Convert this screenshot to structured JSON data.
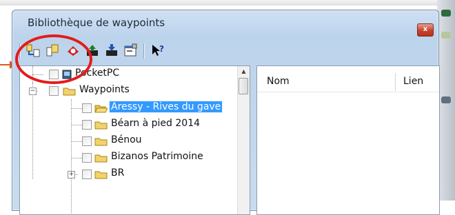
{
  "window": {
    "title": "Bibliothèque de waypoints",
    "close_glyph": "x"
  },
  "toolbar": {
    "buttons": [
      {
        "icon": "import-waypoint-icon"
      },
      {
        "icon": "copy-waypoint-icon"
      },
      {
        "icon": "gps-receiver-icon"
      },
      {
        "icon": "upload-to-device-icon"
      },
      {
        "icon": "download-from-device-icon"
      },
      {
        "icon": "properties-icon"
      },
      {
        "icon": "help-pointer-icon"
      }
    ]
  },
  "tree": {
    "items": [
      {
        "label": "PocketPC",
        "kind": "device",
        "selected": false
      },
      {
        "label": "Waypoints",
        "kind": "folder",
        "selected": false,
        "expanded": true
      },
      {
        "label": "Aressy - Rives du gave",
        "kind": "folder-open",
        "selected": true
      },
      {
        "label": "Béarn à pied 2014",
        "kind": "folder",
        "selected": false
      },
      {
        "label": "Bénou",
        "kind": "folder",
        "selected": false
      },
      {
        "label": "Bizanos Patrimoine",
        "kind": "folder",
        "selected": false
      },
      {
        "label": "BR",
        "kind": "folder",
        "selected": false,
        "expandable": true
      }
    ]
  },
  "list": {
    "columns": [
      "Nom",
      "Lien"
    ]
  },
  "colors": {
    "selection": "#3399ff",
    "annotation_circle": "#e41b1b",
    "annotation_arrow": "#e2551b"
  }
}
